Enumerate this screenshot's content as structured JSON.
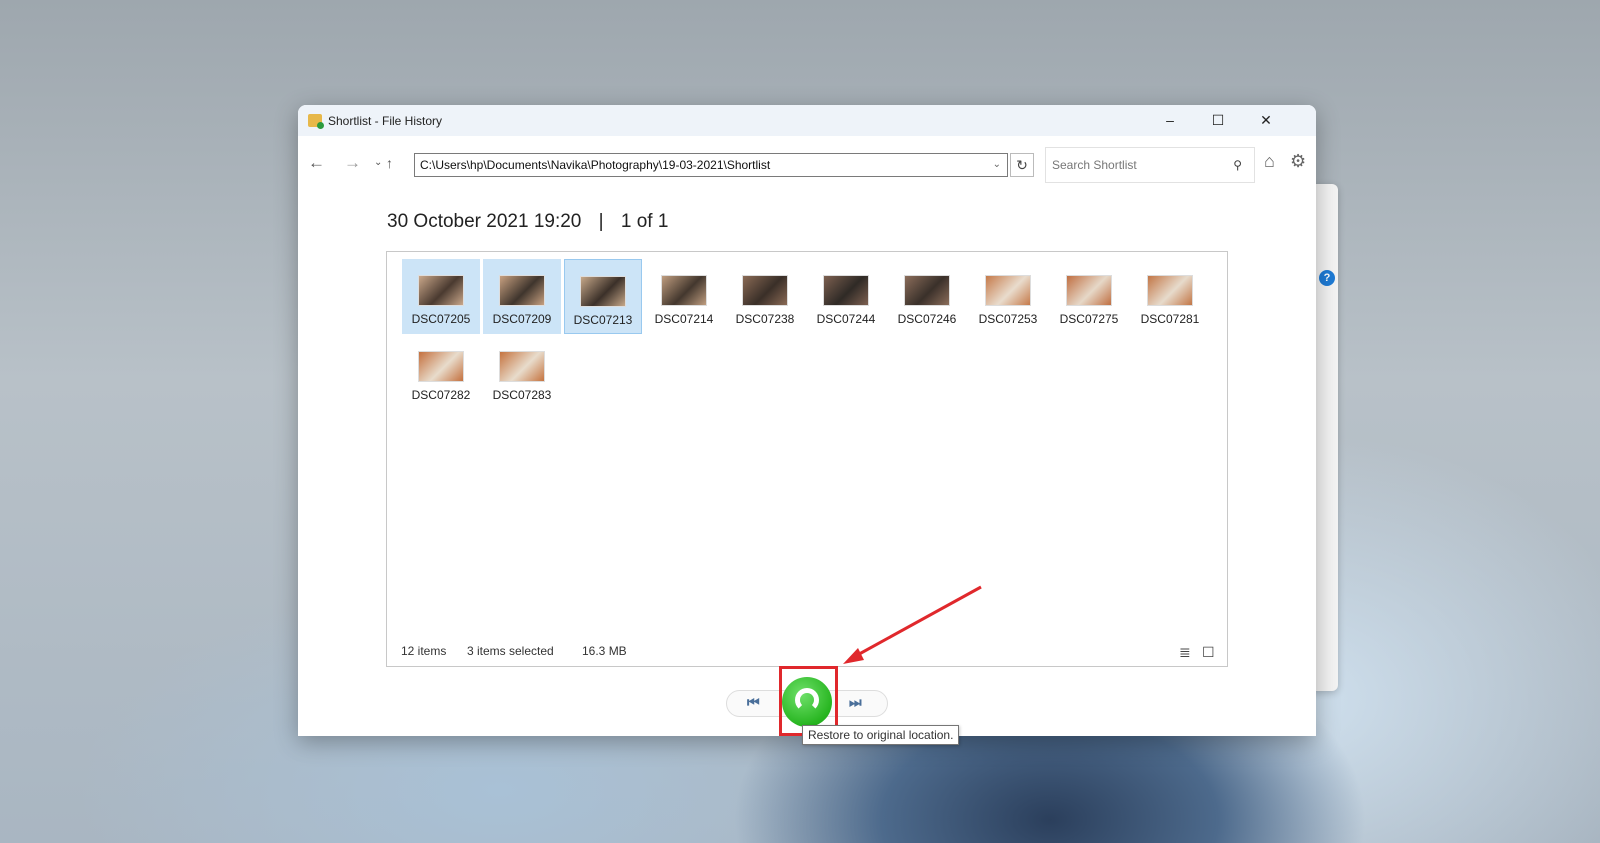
{
  "window": {
    "title": "Shortlist - File History",
    "minimize": "–",
    "maximize": "☐",
    "close": "✕"
  },
  "toolbar": {
    "back": "←",
    "forward": "→",
    "recent": "⌄",
    "up": "↑",
    "address": "C:\\Users\\hp\\Documents\\Navika\\Photography\\19-03-2021\\Shortlist",
    "address_dropdown": "⌄",
    "refresh": "↻",
    "search_placeholder": "Search Shortlist",
    "search_icon": "⚲",
    "home": "⌂",
    "settings": "⚙"
  },
  "header": {
    "date": "30 October 2021 19:20",
    "separator": "|",
    "page": "1 of 1"
  },
  "files": [
    {
      "name": "DSC07205",
      "selected": true
    },
    {
      "name": "DSC07209",
      "selected": true
    },
    {
      "name": "DSC07213",
      "selected": true
    },
    {
      "name": "DSC07214",
      "selected": false
    },
    {
      "name": "DSC07238",
      "selected": false
    },
    {
      "name": "DSC07244",
      "selected": false
    },
    {
      "name": "DSC07246",
      "selected": false
    },
    {
      "name": "DSC07253",
      "selected": false
    },
    {
      "name": "DSC07275",
      "selected": false
    },
    {
      "name": "DSC07281",
      "selected": false
    },
    {
      "name": "DSC07282",
      "selected": false
    },
    {
      "name": "DSC07283",
      "selected": false
    }
  ],
  "status": {
    "count": "12 items",
    "selected": "3 items selected",
    "size": "16.3 MB",
    "details_view": "≣",
    "thumb_view": "☐"
  },
  "playback": {
    "previous": "⏮",
    "next": "⏭",
    "restore_tooltip": "Restore to original location."
  },
  "colors": {
    "selection": "#cce4f7",
    "restore": "#27b520",
    "highlight": "#e0282c"
  },
  "help": "?"
}
